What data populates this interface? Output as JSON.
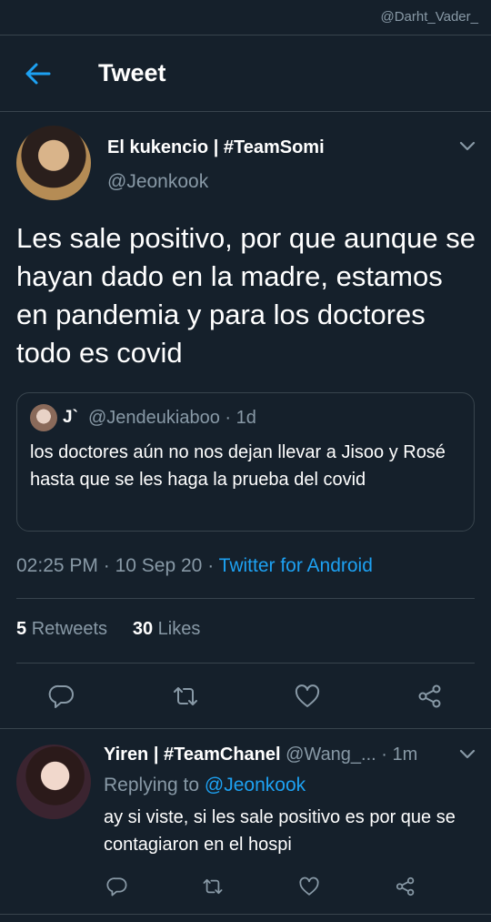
{
  "watermark": "@Darht_Vader_",
  "header": {
    "title": "Tweet",
    "back_icon": "arrow-left-icon"
  },
  "colors": {
    "background": "#15202b",
    "accent": "#1da1f2",
    "secondary_text": "#8899a6",
    "border": "#38444d"
  },
  "tweet": {
    "author_name": "El kukencio | #TeamSomi",
    "author_handle": "@Jeonkook",
    "text": "Les sale positivo, por que aunque se hayan dado en la madre, estamos en pandemia y para los doctores todo es covid",
    "quote": {
      "name": "J`",
      "handle": "@Jendeukiaboo",
      "separator": "·",
      "time": "1d",
      "text": "los doctores aún no nos dejan llevar a Jisoo y Rosé hasta que se les haga la prueba del covid"
    },
    "time": "02:25 PM",
    "dot1": "·",
    "date": "10 Sep 20",
    "dot2": "·",
    "source": "Twitter for Android",
    "retweets_count": "5",
    "retweets_label": "Retweets",
    "likes_count": "30",
    "likes_label": "Likes"
  },
  "reply": {
    "name": "Yiren | #TeamChanel",
    "handle": "@Wang_...",
    "separator": "·",
    "time": "1m",
    "replying_label": "Replying to",
    "replying_handle": "@Jeonkook",
    "text": "ay si viste, si les sale positivo es por que se contagiaron en el hospi"
  },
  "actions": [
    "reply-icon",
    "retweet-icon",
    "like-icon",
    "share-icon"
  ]
}
